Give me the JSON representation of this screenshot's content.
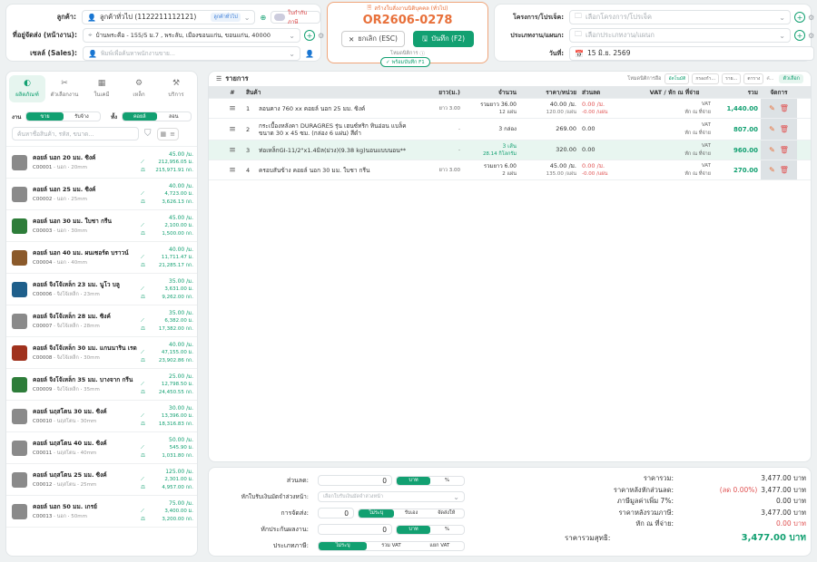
{
  "header": {
    "customer_label": "ลูกค้า:",
    "customer_value": "ลูกค้าทั่วไป (1122211112121)",
    "customer_badge": "ลูกค้าทั่วไป",
    "tax_invoice_label": "ใบกำกับภาษี",
    "address_label": "ที่อยู่จัดส่ง (หน้างาน):",
    "address_value": "บ้านพระคือ - 155/5 ม.7 , พระลับ, เมืองขอนแก่น, ขอนแก่น, 40000",
    "sales_label": "เซลล์ (Sales):",
    "sales_placeholder": "พิมพ์เพื่อค้นหาพนักงานขาย...",
    "order_caption": "สร้างใบสั่งงานนิติบุคคล (ทั่วไป)",
    "order_no": "OR2606-0278",
    "cancel_label": "ยกเลิก (ESC)",
    "save_label": "บันทึก (F2)",
    "note_label": "โหมดนิติการ",
    "status_badge": "พร้อมบันทึก F1",
    "project_label": "โครงการ/โปรเจ็ค:",
    "project_placeholder": "เลือกโครงการ/โปรเจ็ค",
    "jobtype_label": "ประเภทงาน/แผนก:",
    "jobtype_placeholder": "เลือกประเภทงาน/แผนก",
    "date_label": "วันที่:",
    "date_value": "15 มิ.ย. 2569"
  },
  "left": {
    "tabs": [
      {
        "icon": "◐",
        "label": "ผลิตภัณฑ์"
      },
      {
        "icon": "✂",
        "label": "ตัวเลือกงาน"
      },
      {
        "icon": "▦",
        "label": "ในเคมี"
      },
      {
        "icon": "⚙",
        "label": "เหล็ก"
      },
      {
        "icon": "⚒",
        "label": "บริการ"
      }
    ],
    "filter1_label": "งาน",
    "filter1_opts": [
      "ขาย",
      "รับจ้าง"
    ],
    "filter2_label": "ทั้ง",
    "filter2_opts": [
      "คอยล์",
      "ลอน"
    ],
    "search_placeholder": "ค้นหาชื่อสินค้า, รหัส, ขนาด...",
    "products": [
      {
        "name": "คอยล์ นอก 20 มม. ซิงค์",
        "code": "C00001",
        "type": "นอก",
        "size": "20mm",
        "p1": "45.00 /ม.",
        "p2": "212,956.05 ม.",
        "p3": "215,971.91 กก.",
        "color": "#8a8a8a"
      },
      {
        "name": "คอยล์ นอก 25 มม. ซิงค์",
        "code": "C00002",
        "type": "นอก",
        "size": "25mm",
        "p1": "40.00 /ม.",
        "p2": "4,723.00 ม.",
        "p3": "3,626.13 กก.",
        "color": "#8a8a8a"
      },
      {
        "name": "คอยล์ นอก 30 มม. ใบชา กรีน",
        "code": "C00003",
        "type": "นอก",
        "size": "30mm",
        "p1": "45.00 /ม.",
        "p2": "2,100.00 ม.",
        "p3": "1,500.00 กก.",
        "color": "#2e7d3a"
      },
      {
        "name": "คอยล์ นอก 40 มม. ผนเซอร์ต บราวน์",
        "code": "C00004",
        "type": "นอก",
        "size": "40mm",
        "p1": "40.00 /ม.",
        "p2": "11,711.47 ม.",
        "p3": "21,285.17 กก.",
        "color": "#8b5a2b"
      },
      {
        "name": "คอยล์ จิงโจ้เหล็ก 23 มม. นูโว บลู",
        "code": "C00006",
        "type": "จิงโจ้เหล็ก",
        "size": "23mm",
        "p1": "35.00 /ม.",
        "p2": "3,631.00 ม.",
        "p3": "9,262.00 กก.",
        "color": "#1f5f8b"
      },
      {
        "name": "คอยล์ จิงโจ้เหล็ก 28 มม. ซิงค์",
        "code": "C00007",
        "type": "จิงโจ้เหล็ก",
        "size": "28mm",
        "p1": "35.00 /ม.",
        "p2": "6,382.00 ม.",
        "p3": "17,382.00 กก.",
        "color": "#8a8a8a"
      },
      {
        "name": "คอยล์ จิงโจ้เหล็ก 30 มม. แกนนาริน เรด",
        "code": "C00008",
        "type": "จิงโจ้เหล็ก",
        "size": "30mm",
        "p1": "40.00 /ม.",
        "p2": "47,155.00 ม.",
        "p3": "23,902.86 กก.",
        "color": "#a0321e"
      },
      {
        "name": "คอยล์ จิงโจ้เหล็ก 35 มม. บางจาก กรีน",
        "code": "C00009",
        "type": "จิงโจ้เหล็ก",
        "size": "35mm",
        "p1": "25.00 /ม.",
        "p2": "12,798.50 ม.",
        "p3": "24,450.55 กก.",
        "color": "#2e7d3a"
      },
      {
        "name": "คอยล์ นฤสโตน 30 มม. ซิงค์",
        "code": "C00010",
        "type": "นฤสโตน",
        "size": "30mm",
        "p1": "30.00 /ม.",
        "p2": "13,396.00 ม.",
        "p3": "18,316.83 กก.",
        "color": "#8a8a8a"
      },
      {
        "name": "คอยล์ นฤสโตน 40 มม. ซิงค์",
        "code": "C00011",
        "type": "นฤสโตน",
        "size": "40mm",
        "p1": "50.00 /ม.",
        "p2": "545.90 ม.",
        "p3": "1,031.80 กก.",
        "color": "#8a8a8a"
      },
      {
        "name": "คอยล์ นฤสโตน 25 มม. ซิงค์",
        "code": "C00012",
        "type": "นฤสโตน",
        "size": "25mm",
        "p1": "125.00 /ม.",
        "p2": "2,301.00 ม.",
        "p3": "4,957.00 กก.",
        "color": "#8a8a8a"
      },
      {
        "name": "คอยล์ นอก 50 มม. เกรย์",
        "code": "C00013",
        "type": "นอก",
        "size": "50mm",
        "p1": "75.00 /ม.",
        "p2": "3,400.00 ม.",
        "p3": "3,200.00 กก.",
        "color": "#8a8a8a"
      }
    ]
  },
  "items": {
    "title": "รายการ",
    "mode_label": "โหมดนิติการฮือ",
    "btn1": "อัตโนมัติ",
    "btn2": "กรองกำ...",
    "btn3": "ราย...",
    "btn4": "ตาราง",
    "btn5": "คั...",
    "btn6": "ตัวเลือก",
    "headers": [
      "#",
      "สินค้า",
      "ยาว(ม.)",
      "จำนวน",
      "ราคา/หน่วย",
      "ส่วนลด",
      "VAT / หัก ณ ที่จ่าย",
      "รวม",
      "จัดการ"
    ],
    "rows": [
      {
        "no": "1",
        "name": "ลอนคาง 760 xx คอยล์ นอก 25 มม. ซิงค์",
        "length": "ยาว 3.00",
        "qty1": "รวมยาว 36.00",
        "qty2": "12 แผ่น",
        "price1": "40.00 /ม.",
        "price2": "120.00 /แผ่น",
        "disc1": "0.00 /ม.",
        "disc2": "-0.00 /แผ่น",
        "vat1": "VAT",
        "vat2": "หัก ณ ที่จ่าย",
        "total": "1,440.00"
      },
      {
        "no": "2",
        "name": "กระเบื้องหลังคา DURAGRES รุ่น เฮนซ์ทริก ทินอ่อน แบล็ค ขนาด 30 x 45 ซม. (กล่อง 6 แผ่น) สีดำ",
        "length": "-",
        "qty1": "3 กล่อง",
        "qty2": "",
        "price1": "269.00",
        "price2": "",
        "disc1": "0.00",
        "disc2": "",
        "vat1": "VAT",
        "vat2": "หัก ณ ที่จ่าย",
        "total": "807.00"
      },
      {
        "no": "3",
        "name": "ท่อเหล็กGI-11/2\"x1.4มิล(ม่วง)(9.38 kg)นอนแบบนอน**",
        "length": "-",
        "qty1": "3 เส้น",
        "qty2": "28.14 กิโลกรัม",
        "price1": "320.00",
        "price2": "",
        "disc1": "0.00",
        "disc2": "",
        "vat1": "VAT",
        "vat2": "หัก ณ ที่จ่าย",
        "total": "960.00"
      },
      {
        "no": "4",
        "name": "ครอบสันข้าง คอยล์ นอก 30 มม. ใบชา กรีน",
        "length": "ยาว 3.00",
        "qty1": "รวมยาว 6.00",
        "qty2": "2 แผ่น",
        "price1": "45.00 /ม.",
        "price2": "135.00 /แผ่น",
        "disc1": "0.00 /ม.",
        "disc2": "-0.00 /แผ่น",
        "vat1": "VAT",
        "vat2": "หัก ณ ที่จ่าย",
        "total": "270.00"
      }
    ]
  },
  "summary": {
    "discount_label": "ส่วนลด:",
    "discount_value": "0",
    "unit_baht": "บาท",
    "unit_pct": "%",
    "deposit_label": "หักใบรับเงินมัดจำล่วงหน้า:",
    "deposit_placeholder": "เลือกใบรับเงินมัดจำล่วงหน้า",
    "shipping_label": "การจัดส่ง:",
    "shipping_value": "0",
    "ship_opts": [
      "ไม่ระบุ",
      "รับเอง",
      "จัดส่งให้"
    ],
    "warranty_label": "หักประกันผลงาน:",
    "warranty_value": "0",
    "vattype_label": "ประเภทภาษี:",
    "vat_opts": [
      "ไม่ระบุ",
      "รวม VAT",
      "แยก VAT"
    ],
    "totals": [
      {
        "label": "ราคารวม:",
        "value": "3,477.00 บาท",
        "extra": ""
      },
      {
        "label": "ราคาหลังหักส่วนลด:",
        "value": "3,477.00 บาท",
        "extra": "(ลด 0.00%)"
      },
      {
        "label": "ภาษีมูลค่าเพิ่ม 7%:",
        "value": "0.00 บาท",
        "extra": ""
      },
      {
        "label": "ราคาหลังรวมภาษี:",
        "value": "3,477.00 บาท",
        "extra": ""
      },
      {
        "label": "หัก ณ ที่จ่าย:",
        "value": "0.00 บาท",
        "extra": ""
      }
    ],
    "net_label": "ราคารวมสุทธิ:",
    "net_value": "3,477.00 บาท"
  },
  "colors": {
    "accent": "#12a071",
    "order": "#e8703a",
    "danger": "#e05252"
  }
}
